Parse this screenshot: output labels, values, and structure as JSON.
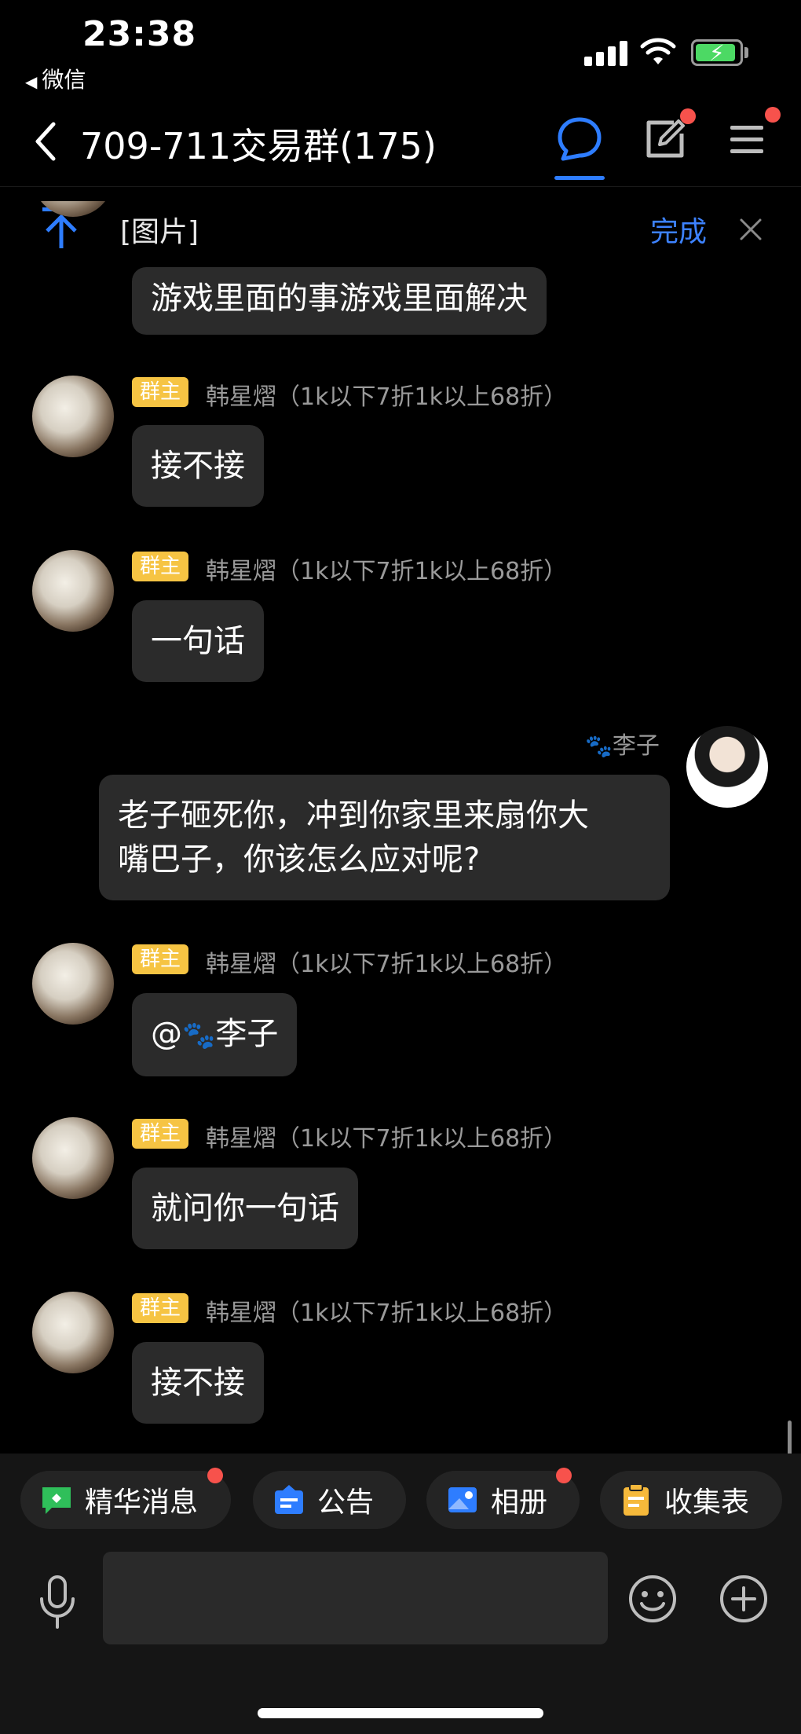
{
  "status_bar": {
    "time": "23:38",
    "back_app": "微信"
  },
  "nav": {
    "title": "709-711交易群(175)"
  },
  "pinned": {
    "text": "[图片]",
    "done": "完成"
  },
  "messages": [
    {
      "type": "received",
      "text": "游戏里面的事游戏里面解决"
    },
    {
      "type": "received",
      "badge": "群主",
      "sender": "韩星熠（1k以下7折1k以上68折）",
      "text": "接不接"
    },
    {
      "type": "received",
      "badge": "群主",
      "sender": "韩星熠（1k以下7折1k以上68折）",
      "text": "一句话"
    },
    {
      "type": "sent",
      "sender": "李子",
      "text_line1": "老子砸死你，冲到你家里来扇你大",
      "text_line2": "嘴巴子，你该怎么应对呢?"
    },
    {
      "type": "received",
      "badge": "群主",
      "sender": "韩星熠（1k以下7折1k以上68折）",
      "mention_prefix": "@",
      "mention_name": "李子"
    },
    {
      "type": "received",
      "badge": "群主",
      "sender": "韩星熠（1k以下7折1k以上68折）",
      "text": "就问你一句话"
    },
    {
      "type": "received",
      "badge": "群主",
      "sender": "韩星熠（1k以下7折1k以上68折）",
      "text": "接不接"
    }
  ],
  "quick_actions": [
    {
      "label": "精华消息",
      "icon": "essence-icon",
      "color": "#2fbf5a",
      "has_dot": true
    },
    {
      "label": "公告",
      "icon": "announcement-icon",
      "color": "#2e7dff",
      "has_dot": false
    },
    {
      "label": "相册",
      "icon": "album-icon",
      "color": "#2e7dff",
      "has_dot": true
    },
    {
      "label": "收集表",
      "icon": "form-icon",
      "color": "#f6b93b",
      "has_dot": false
    }
  ],
  "colors": {
    "accent": "#2e7dff",
    "badge": "#f6c443",
    "bubble": "#2b2b2b",
    "notify": "#f7524c"
  }
}
